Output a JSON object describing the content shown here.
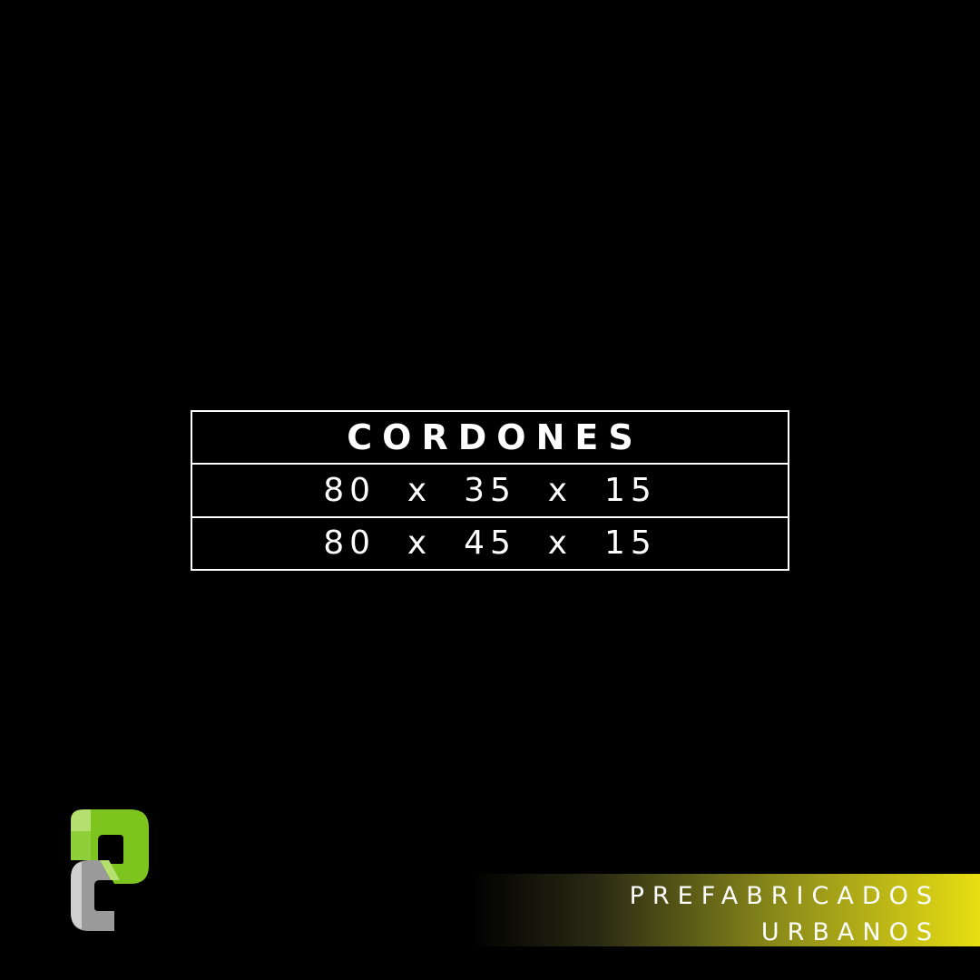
{
  "table": {
    "title": "CORDONES",
    "rows": [
      {
        "label": "80  x  35  x  15"
      },
      {
        "label": "80  x  45  x  15"
      }
    ]
  },
  "brand": {
    "line1": "PREFABRICADOS",
    "line2": "URBANOS"
  },
  "colors": {
    "background": "#000000",
    "text": "#ffffff",
    "logo_green": "#7dc41f",
    "logo_light_green": "#b5df6e",
    "logo_gray": "#9a9a9a",
    "logo_light_gray": "#cfcfcf",
    "band_yellow": "#e8de12"
  },
  "logo": {
    "icon": "pc-logo-icon"
  }
}
